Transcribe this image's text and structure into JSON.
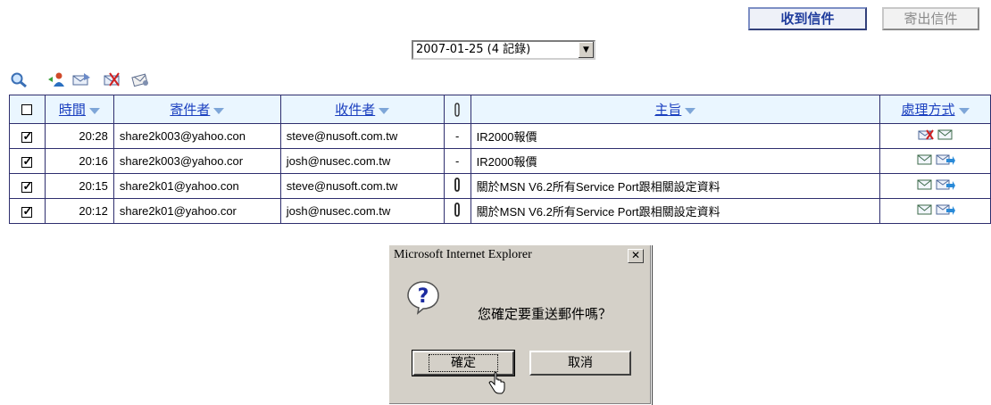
{
  "tabs": {
    "inbox": "收到信件",
    "outbox": "寄出信件"
  },
  "date_filter": {
    "selected": "2007-01-25 (4 記錄)"
  },
  "toolbar": [
    {
      "icon": "search-icon"
    },
    {
      "icon": "add-contact-icon"
    },
    {
      "icon": "resend-mail-icon"
    },
    {
      "icon": "delete-mail-icon"
    },
    {
      "icon": "forward-mail-icon"
    }
  ],
  "table": {
    "headers": {
      "time": "時間",
      "sender": "寄件者",
      "recipient": "收件者",
      "subject": "主旨",
      "action": "處理方式"
    },
    "rows": [
      {
        "checked": true,
        "time": "20:28",
        "sender": "share2k003@yahoo.con",
        "recipient": "steve@nusoft.com.tw",
        "attachment": "-",
        "subject": "IR2000報價",
        "actions": [
          "blocked-mail-icon",
          "mail-icon"
        ]
      },
      {
        "checked": true,
        "time": "20:16",
        "sender": "share2k003@yahoo.cor",
        "recipient": "josh@nusec.com.tw",
        "attachment": "-",
        "subject": "IR2000報價",
        "actions": [
          "mail-icon",
          "forward-icon"
        ]
      },
      {
        "checked": true,
        "time": "20:15",
        "sender": "share2k01@yahoo.con",
        "recipient": "steve@nusoft.com.tw",
        "attachment": "paperclip-icon",
        "subject": "關於MSN V6.2所有Service Port跟相關設定資料",
        "actions": [
          "mail-icon",
          "forward-icon"
        ]
      },
      {
        "checked": true,
        "time": "20:12",
        "sender": "share2k01@yahoo.cor",
        "recipient": "josh@nusec.com.tw",
        "attachment": "paperclip-icon",
        "subject": "關於MSN V6.2所有Service Port跟相關設定資料",
        "actions": [
          "mail-icon",
          "forward-icon"
        ]
      }
    ]
  },
  "dialog": {
    "title": "Microsoft Internet Explorer",
    "message": "您確定要重送郵件嗎？",
    "ok_label": "確定",
    "cancel_label": "取消"
  },
  "colors": {
    "link_blue": "#1a3fbf",
    "header_bg": "#eaf6ff",
    "dialog_bg": "#d4d0c8"
  }
}
